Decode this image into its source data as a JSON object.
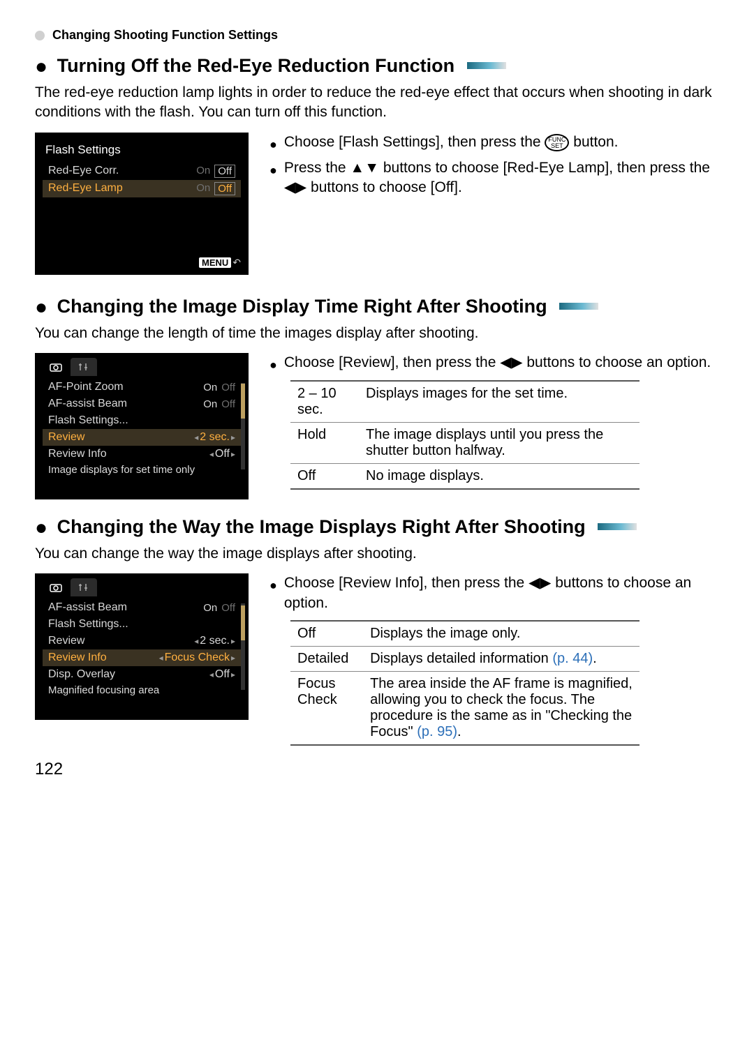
{
  "breadcrumb": "Changing Shooting Function Settings",
  "section1": {
    "title": " Turning Off the Red-Eye Reduction Function",
    "body": "The red-eye reduction lamp lights in order to reduce the red-eye effect that occurs when shooting in dark conditions with the flash. You can turn off this function.",
    "lcd": {
      "title": "Flash Settings",
      "rows": [
        {
          "label": "Red-Eye Corr.",
          "on": "On",
          "off": "Off",
          "sel": false,
          "box": "off"
        },
        {
          "label": "Red-Eye Lamp",
          "on": "On",
          "off": "Off",
          "sel": true,
          "box": "off"
        }
      ],
      "menu": "MENU"
    },
    "steps": [
      {
        "pre": "Choose [Flash Settings], then press the ",
        "post": " button.",
        "icon": "funcset"
      },
      {
        "pre": "Press the ",
        "mid": " buttons to choose [Red-Eye Lamp], then press the ",
        "post": " buttons to choose [Off].",
        "icon1": "updown",
        "icon2": "leftright"
      }
    ]
  },
  "section2": {
    "title": " Changing the Image Display Time Right After Shooting",
    "body": "You can change the length of time the images display after shooting.",
    "lcd": {
      "rows": [
        {
          "label": "AF-Point Zoom",
          "val": "On",
          "val2": "Off",
          "type": "toggle",
          "sel": false
        },
        {
          "label": "AF-assist Beam",
          "val": "On",
          "val2": "Off",
          "type": "toggle",
          "sel": false
        },
        {
          "label": "Flash Settings...",
          "val": "",
          "type": "submenu",
          "sel": false
        },
        {
          "label": "Review",
          "val": "2 sec.",
          "type": "lr",
          "sel": true
        },
        {
          "label": "Review Info",
          "val": "Off",
          "type": "lr",
          "sel": false
        }
      ],
      "help": "Image displays for set time only"
    },
    "step": {
      "pre": "Choose [Review], then press the ",
      "post": " buttons to choose an option.",
      "icon": "leftright"
    },
    "table": [
      {
        "k": "2 – 10 sec.",
        "v": "Displays images for the set time."
      },
      {
        "k": "Hold",
        "v": "The image displays until you press the shutter button halfway."
      },
      {
        "k": "Off",
        "v": "No image displays."
      }
    ]
  },
  "section3": {
    "title": " Changing the Way the Image Displays Right After Shooting",
    "body": "You can change the way the image displays after shooting.",
    "lcd": {
      "rows": [
        {
          "label": "AF-assist Beam",
          "val": "On",
          "val2": "Off",
          "type": "toggle",
          "sel": false
        },
        {
          "label": "Flash Settings...",
          "val": "",
          "type": "submenu",
          "sel": false
        },
        {
          "label": "Review",
          "val": "2 sec.",
          "type": "lr",
          "sel": false
        },
        {
          "label": "Review Info",
          "val": "Focus Check",
          "type": "lr",
          "sel": true
        },
        {
          "label": "Disp. Overlay",
          "val": "Off",
          "type": "lr",
          "sel": false
        }
      ],
      "help": "Magnified focusing area"
    },
    "step": {
      "pre": "Choose [Review Info], then press the ",
      "post": " buttons to choose an option.",
      "icon": "leftright"
    },
    "table": [
      {
        "k": "Off",
        "v": "Displays the image only."
      },
      {
        "k": "Detailed",
        "v": "Displays detailed information ",
        "link": "(p. 44)",
        "after": "."
      },
      {
        "k": "Focus Check",
        "v": "The area inside the AF frame is magnified, allowing you to check the focus. The procedure is the same as in \"Checking the Focus\" ",
        "link": "(p. 95)",
        "after": "."
      }
    ]
  },
  "pageNumber": "122",
  "glyphs": {
    "bullet": "●",
    "updown": "▲▼",
    "leftright": "◀▶",
    "back": "↶",
    "func_top": "FUNC",
    "func_bot": "SET"
  }
}
